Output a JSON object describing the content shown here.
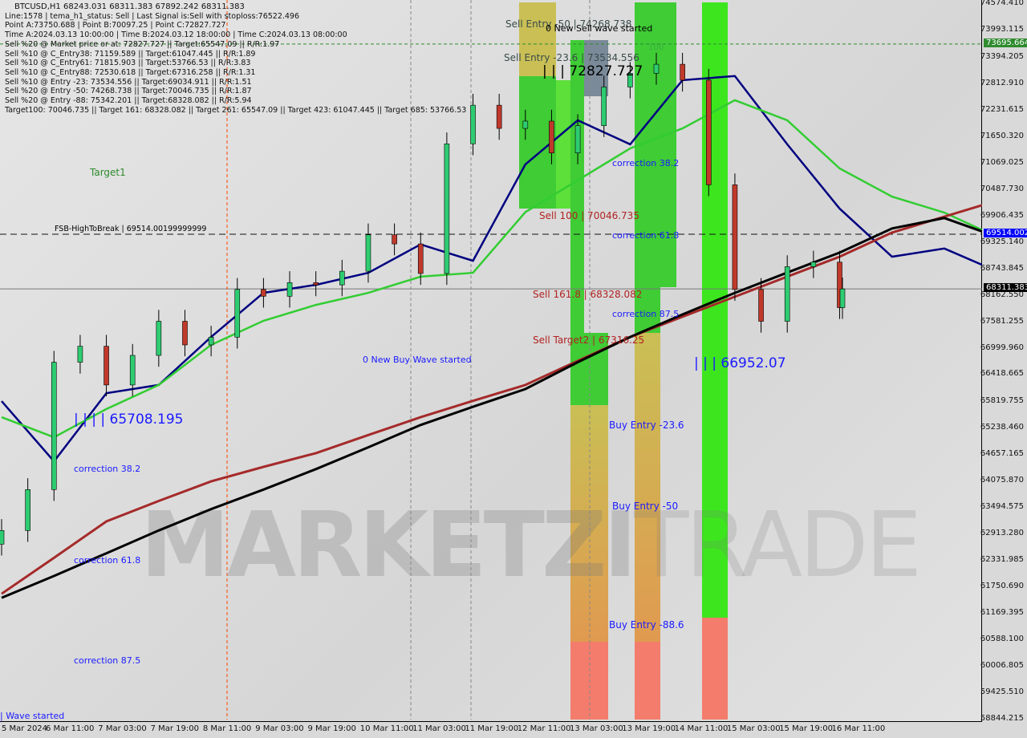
{
  "header": {
    "symbol_line": "BTCUSD,H1  68243.031 68311.383 67892.242 68311.383",
    "lines": [
      "Line:1578 | tema_h1_status: Sell | Last Signal is:Sell with stoploss:76522.496",
      "Point A:73750.688 | Point B:70097.25 | Point C:72827.727",
      "Time A:2024.03.13 10:00:00 | Time B:2024.03.12 18:00:00 | Time C:2024.03.13 08:00:00",
      "Sell %20 @ Market price or at: 72827.727 || Target:65547.09 || R/R:1.97",
      "Sell %10 @ C_Entry38: 71159.589 || Target:61047.445 || R/R:1.89",
      "Sell %10 @ C_Entry61: 71815.903 || Target:53766.53 || R/R:3.83",
      "Sell %10 @ C_Entry88: 72530.618 || Target:67316.258 || R/R:1.31",
      "Sell %10 @ Entry -23: 73534.556 || Target:69034.911 || R/R:1.51",
      "Sell %20 @ Entry -50: 74268.738 || Target:70046.735 || R/R:1.87",
      "Sell %20 @ Entry -88: 75342.201 || Target:68328.082 || R/R:5.94",
      "Target100: 70046.735 || Target 161: 68328.082 || Target 261: 65547.09 || Target 423: 61047.445 || Target 685: 53766.53"
    ]
  },
  "annotations": [
    {
      "text": "Sell Entry -50 | 74268.738",
      "color": "#3a4a4a"
    },
    {
      "text": "0 New Sell wave started",
      "color": "#000000"
    },
    {
      "text": "Sell Entry -23.6 | 73534.556",
      "color": "#3a4a4a"
    },
    {
      "text": "| | | 72827.727",
      "color": "#000000"
    },
    {
      "text": "Target1",
      "color": "#2e8b2e"
    },
    {
      "text": "FSB-HighToBreak | 69514.00199999999",
      "color": "#000000"
    },
    {
      "text": "correction 38.2",
      "color": "#1a1aff"
    },
    {
      "text": "Sell 100 | 70046.735",
      "color": "#b22222"
    },
    {
      "text": "correction 61.8",
      "color": "#1a1aff"
    },
    {
      "text": "Sell 161.8 | 68328.082",
      "color": "#b22222"
    },
    {
      "text": "correction 87.5",
      "color": "#1a1aff"
    },
    {
      "text": "Sell Target2 | 67316.25",
      "color": "#b22222"
    },
    {
      "text": "0 New Buy Wave started",
      "color": "#1a1aff"
    },
    {
      "text": "| | | 66952.07",
      "color": "#1a1aff"
    },
    {
      "text": "| | | | 65708.195",
      "color": "#1a1aff"
    },
    {
      "text": "Buy Entry -23.6",
      "color": "#1a1aff"
    },
    {
      "text": "correction 38.2",
      "color": "#1a1aff"
    },
    {
      "text": "Buy Entry -50",
      "color": "#1a1aff"
    },
    {
      "text": "correction 61.8",
      "color": "#1a1aff"
    },
    {
      "text": "Buy Entry -88.6",
      "color": "#1a1aff"
    },
    {
      "text": "correction 87.5",
      "color": "#1a1aff"
    },
    {
      "text": "| Wave started",
      "color": "#1a1aff"
    },
    {
      "text": "100",
      "color": "#3cb043"
    }
  ],
  "watermark": {
    "bold": "MARKETZI",
    "light": "TRADE"
  },
  "chart_data": {
    "type": "candlestick",
    "ylim": [
      58844.215,
      74574.41
    ],
    "xlim": [
      "2024-03-05 19:00",
      "2024-03-16 13:00"
    ],
    "y_ticks": [
      "74574.410",
      "73993.115",
      "73394.205",
      "72812.910",
      "72231.615",
      "71650.320",
      "71069.025",
      "70487.730",
      "69906.435",
      "69325.140",
      "68743.845",
      "68162.550",
      "67581.255",
      "66999.960",
      "66418.665",
      "65819.755",
      "65238.460",
      "64657.165",
      "64075.870",
      "63494.575",
      "62913.280",
      "62331.985",
      "61750.690",
      "61169.395",
      "60588.100",
      "60006.805",
      "59425.510",
      "58844.215"
    ],
    "x_ticks": [
      "5 Mar 2024",
      "6 Mar 11:00",
      "7 Mar 03:00",
      "7 Mar 19:00",
      "8 Mar 11:00",
      "9 Mar 03:00",
      "9 Mar 19:00",
      "10 Mar 11:00",
      "11 Mar 03:00",
      "11 Mar 19:00",
      "12 Mar 11:00",
      "13 Mar 03:00",
      "13 Mar 19:00",
      "14 Mar 11:00",
      "15 Mar 03:00",
      "15 Mar 19:00",
      "16 Mar 11:00"
    ],
    "price_tags": [
      {
        "label": "73695.664",
        "value": 73695.664,
        "color": "#2e8b2e"
      },
      {
        "label": "69514.002",
        "value": 69514.002,
        "color": "#0000ff"
      },
      {
        "label": "68311.383",
        "value": 68311.383,
        "color": "#000000"
      }
    ],
    "close_series": {
      "start": "2024-03-05 19:00",
      "step_hours": 8,
      "values": [
        63000,
        63900,
        66700,
        67050,
        66200,
        66850,
        67600,
        67080,
        67250,
        68300,
        68150,
        68450,
        68400,
        68700,
        69500,
        69300,
        68650,
        71500,
        72350,
        71840,
        72000,
        71300,
        71900,
        72750,
        73050,
        73250,
        72900,
        70600,
        68300,
        67600,
        68800,
        68900,
        67900,
        68311.383
      ]
    },
    "overlays": [
      {
        "color": "#000080",
        "start": "2024-03-05 19:00",
        "step_hours": 16,
        "values": [
          65844,
          64520,
          66020,
          66200,
          67255,
          68225,
          68400,
          68665,
          69290,
          68930,
          71050,
          72017,
          71490,
          72900,
          72990,
          71490,
          70075,
          69020,
          69200,
          68700
        ]
      },
      {
        "color": "#32cd32",
        "start": "2024-03-05 19:00",
        "step_hours": 16,
        "values": [
          65490,
          65050,
          65670,
          66200,
          67080,
          67610,
          67960,
          68225,
          68580,
          68665,
          70000,
          70700,
          71400,
          71840,
          72460,
          72020,
          70960,
          70340,
          69990,
          69460
        ]
      },
      {
        "color": "#a52a2a",
        "start": "2024-03-05 19:00",
        "step_hours": 16,
        "values": [
          61610,
          62400,
          63200,
          63650,
          64080,
          64400,
          64700,
          65100,
          65490,
          65850,
          66200,
          66730,
          67255,
          67700,
          68140,
          68580,
          69020,
          69550,
          69900,
          70250
        ]
      },
      {
        "color": "#000000",
        "start": "2024-03-05 19:00",
        "step_hours": 16,
        "values": [
          61520,
          62000,
          62500,
          63000,
          63470,
          63900,
          64350,
          64830,
          65320,
          65720,
          66110,
          66700,
          67255,
          67750,
          68225,
          68670,
          69110,
          69640,
          69870,
          69460
        ]
      }
    ]
  }
}
